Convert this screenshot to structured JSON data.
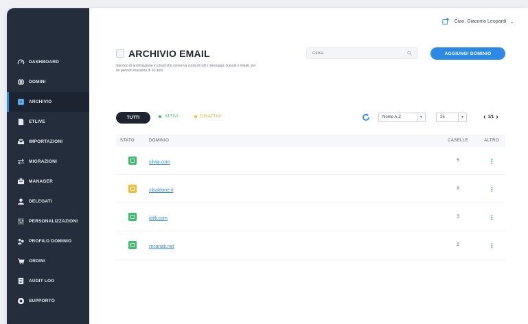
{
  "user": {
    "greeting": "Ciao, Giacomo Leopardi"
  },
  "sidebar": {
    "items": [
      {
        "label": "DASHBOARD",
        "icon": "gauge-icon"
      },
      {
        "label": "DOMINI",
        "icon": "globe-icon"
      },
      {
        "label": "ARCHIVIO",
        "icon": "archive-icon",
        "active": true
      },
      {
        "label": "ETLIVE",
        "icon": "document-icon"
      },
      {
        "label": "IMPORTAZIONI",
        "icon": "inbox-icon"
      },
      {
        "label": "MIGRAZIONI",
        "icon": "arrows-icon"
      },
      {
        "label": "MANAGER",
        "icon": "manager-icon"
      },
      {
        "label": "DELEGATI",
        "icon": "users-icon"
      },
      {
        "label": "PERSONALIZZAZIONI",
        "icon": "sliders-icon"
      },
      {
        "label": "PROFILO DOMINIO",
        "icon": "profile-icon"
      },
      {
        "label": "ORDINI",
        "icon": "cart-icon"
      },
      {
        "label": "AUDIT LOG",
        "icon": "log-icon"
      },
      {
        "label": "SUPPORTO",
        "icon": "support-icon"
      }
    ]
  },
  "page": {
    "title": "ARCHIVIO EMAIL",
    "subtitle": "Servizio di archiviazione in cloud che conserva copia di tutti i messaggi, ricevuti e inviati, per un periodo massimo di 10 anni.",
    "search_placeholder": "Cerca",
    "add_button": "AGGIUNGI DOMINIO"
  },
  "filters": {
    "all": "TUTTI",
    "active": "ATTIVI",
    "disabled": "DISATTIVI",
    "sort": "Nome A-Z",
    "page_size": "25",
    "page": "1/1"
  },
  "table": {
    "headers": {
      "stato": "STATO",
      "dominio": "DOMINIO",
      "caselle": "CASELLE",
      "altro": "ALTRO"
    },
    "rows": [
      {
        "domain": "silvia.com",
        "count": "5",
        "status": "active"
      },
      {
        "domain": "zibaldone.it",
        "count": "8",
        "status": "disabled"
      },
      {
        "domain": "idilli.com",
        "count": "3",
        "status": "active"
      },
      {
        "domain": "recanati.net",
        "count": "2",
        "status": "active"
      }
    ]
  },
  "colors": {
    "accent": "#2d8ae4",
    "sidebar": "#232d3c",
    "status_active": "#3bc06a",
    "status_disabled": "#f1be2f"
  }
}
